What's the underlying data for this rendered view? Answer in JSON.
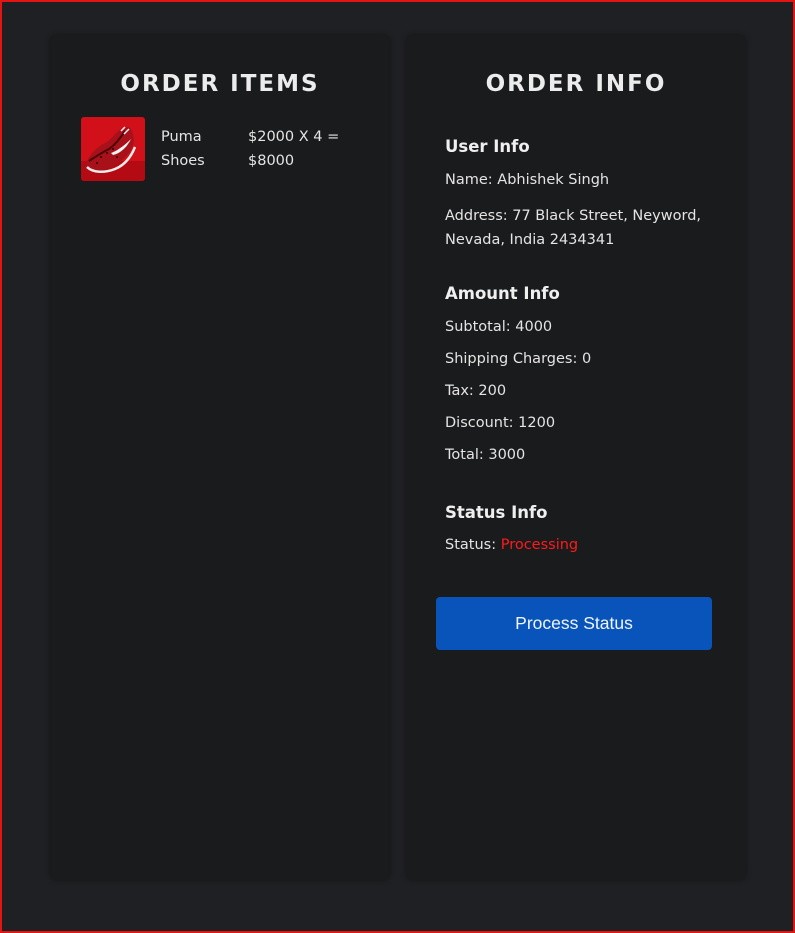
{
  "order_items": {
    "title": "ORDER ITEMS",
    "items": [
      {
        "name": "Puma Shoes",
        "price_line": "$2000 X 4 = $8000",
        "image_icon": "red-sneaker-image"
      }
    ]
  },
  "order_info": {
    "title": "ORDER INFO",
    "user_info": {
      "heading": "User Info",
      "name": "Name: Abhishek Singh",
      "address": "Address: 77 Black Street, Neyword, Nevada, India 2434341"
    },
    "amount_info": {
      "heading": "Amount Info",
      "subtotal": "Subtotal: 4000",
      "shipping": "Shipping Charges: 0",
      "tax": "Tax: 200",
      "discount": "Discount: 1200",
      "total": "Total: 3000"
    },
    "status_info": {
      "heading": "Status Info",
      "status_label": "Status:",
      "status_value": "Processing",
      "status_color": "#ff1a1a"
    },
    "process_button_label": "Process Status"
  },
  "colors": {
    "background": "#1f2023",
    "panel": "#1a1b1d",
    "frame_border": "#e31414",
    "button": "#0854ba"
  }
}
